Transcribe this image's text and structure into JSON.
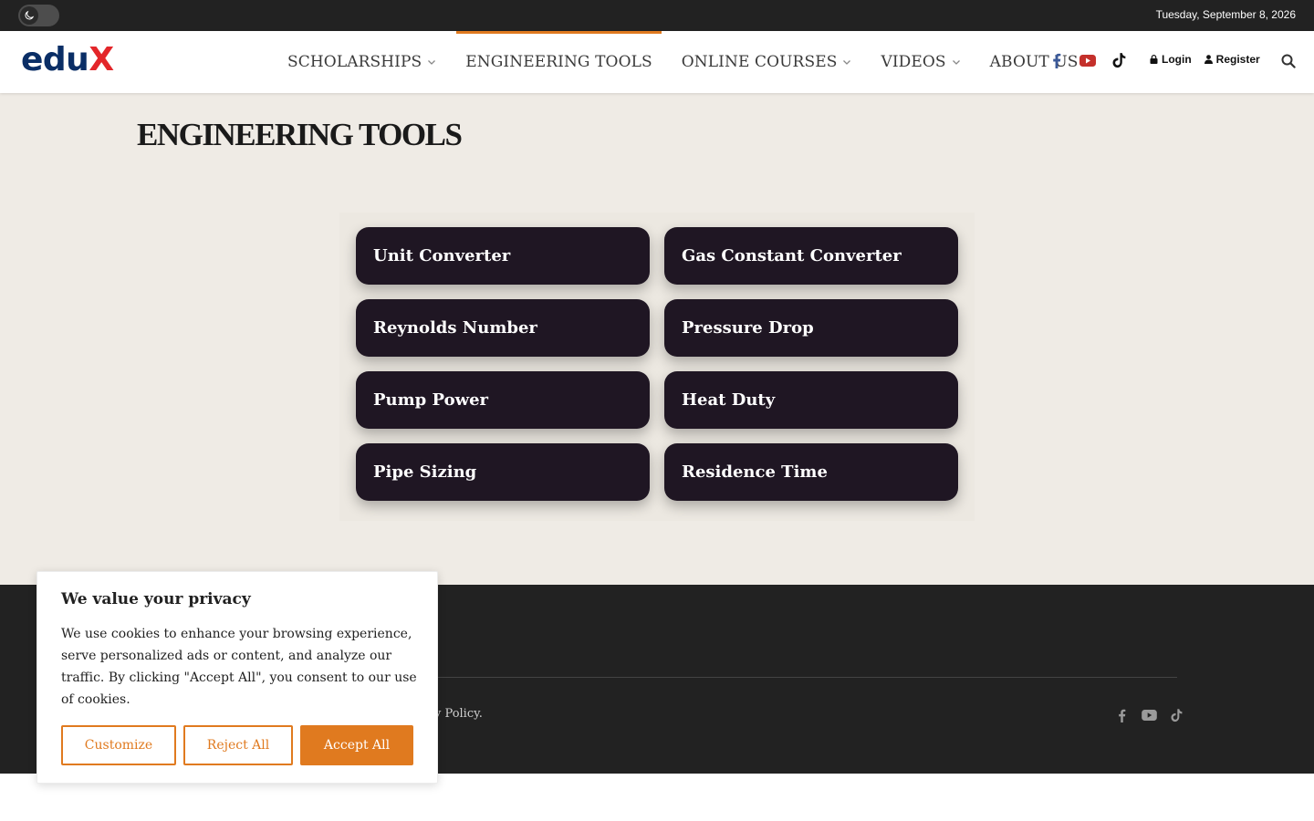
{
  "topbar": {
    "date": "Tuesday, September 8, 2026",
    "dark_mode_icon": "moon-icon"
  },
  "header": {
    "logo": {
      "part1": "edu",
      "part2": "X"
    },
    "nav": [
      {
        "label": "SCHOLARSHIPS",
        "has_dropdown": true
      },
      {
        "label": "ENGINEERING TOOLS",
        "has_dropdown": false,
        "active": true
      },
      {
        "label": "ONLINE COURSES",
        "has_dropdown": true
      },
      {
        "label": "VIDEOS",
        "has_dropdown": true
      },
      {
        "label": "ABOUT US",
        "has_dropdown": false
      }
    ],
    "social": [
      "facebook-icon",
      "youtube-icon",
      "tiktok-icon"
    ],
    "login": "Login",
    "register": "Register",
    "search_icon": "search-icon"
  },
  "main": {
    "title": "ENGINEERING TOOLS",
    "tools": [
      "Unit Converter",
      "Gas Constant Converter",
      "Reynolds Number",
      "Pressure Drop",
      "Pump Power",
      "Heat Duty",
      "Pipe Sizing",
      "Residence Time"
    ]
  },
  "footer": {
    "copyright_fragment": "y Policy.",
    "social": [
      "facebook-icon",
      "youtube-icon",
      "tiktok-icon"
    ]
  },
  "cookie": {
    "title": "We value your privacy",
    "text": "We use cookies to enhance your browsing experience, serve personalized ads or content, and analyze our traffic. By clicking \"Accept All\", you consent to our use of cookies.",
    "customize": "Customize",
    "reject": "Reject All",
    "accept": "Accept All"
  },
  "colors": {
    "accent": "#e07a1f",
    "topbar_bg": "#222222",
    "button_bg": "#1f1623",
    "main_bg": "#efebe5",
    "logo_blue": "#0a2e66",
    "logo_red": "#e3262a"
  }
}
